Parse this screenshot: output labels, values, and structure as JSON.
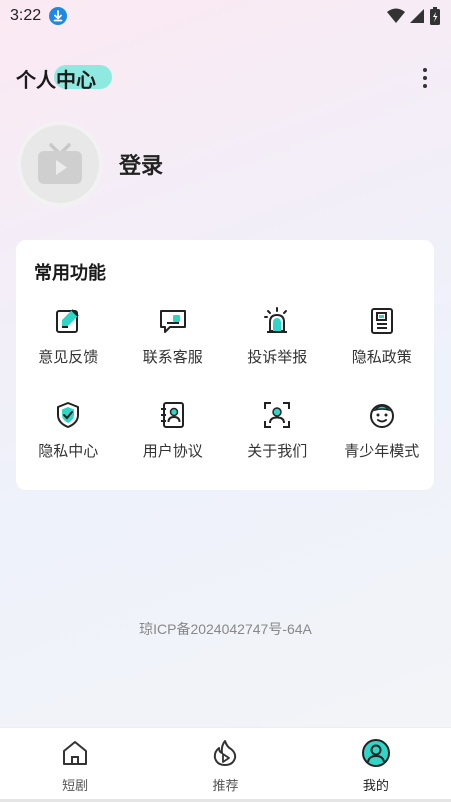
{
  "status_bar": {
    "time": "3:22",
    "icons": [
      "download-icon",
      "wifi-icon",
      "signal-icon",
      "battery-icon"
    ]
  },
  "header": {
    "title": "个人中心",
    "more_icon": "more-vertical-icon",
    "highlight_color": "#8ee9e0"
  },
  "profile": {
    "avatar_icon": "tv-play-icon",
    "login_label": "登录"
  },
  "features": {
    "title": "常用功能",
    "accent_color": "#2fd6c7",
    "items": [
      {
        "label": "意见反馈",
        "icon": "edit-feedback-icon"
      },
      {
        "label": "联系客服",
        "icon": "chat-service-icon"
      },
      {
        "label": "投诉举报",
        "icon": "alarm-report-icon"
      },
      {
        "label": "隐私政策",
        "icon": "document-icon"
      },
      {
        "label": "隐私中心",
        "icon": "shield-check-icon"
      },
      {
        "label": "用户协议",
        "icon": "contact-book-icon"
      },
      {
        "label": "关于我们",
        "icon": "face-scan-icon"
      },
      {
        "label": "青少年模式",
        "icon": "child-face-icon"
      }
    ]
  },
  "footer": {
    "icp": "琼ICP备2024042747号-64A"
  },
  "tabbar": {
    "items": [
      {
        "label": "短剧",
        "icon": "home-icon",
        "active": false
      },
      {
        "label": "推荐",
        "icon": "flame-play-icon",
        "active": false
      },
      {
        "label": "我的",
        "icon": "user-circle-icon",
        "active": true
      }
    ]
  }
}
